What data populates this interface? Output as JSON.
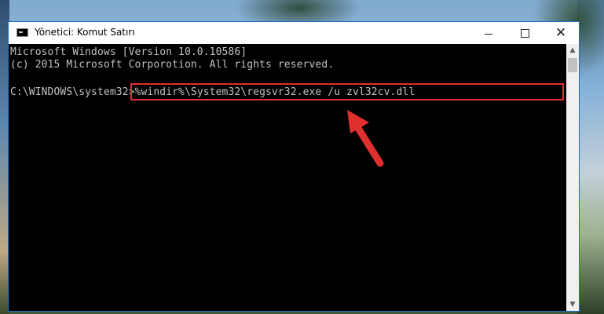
{
  "window": {
    "title": "Yönetici: Komut Satırı",
    "icon": "cmd-icon",
    "controls": {
      "minimize": "minimize-icon",
      "maximize": "maximize-icon",
      "close": "close-icon",
      "close_glyph": "✕"
    }
  },
  "console": {
    "line1": "Microsoft Windows [Version 10.0.10586]",
    "line2": "(c) 2015 Microsoft Corporotion. All rights reserved.",
    "prompt": "C:\\WINDOWS\\system32>",
    "command": "%windir%\\System32\\regsvr32.exe /u zvl32cv.dll"
  },
  "scrollbar": {
    "up_glyph": "▲",
    "down_glyph": "▼"
  },
  "colors": {
    "highlight": "#e0302d",
    "console_text": "#c0c0c0",
    "console_bg": "#000000",
    "window_border": "#1c6fc4"
  },
  "annotation": {
    "icon": "red-arrow-icon"
  }
}
